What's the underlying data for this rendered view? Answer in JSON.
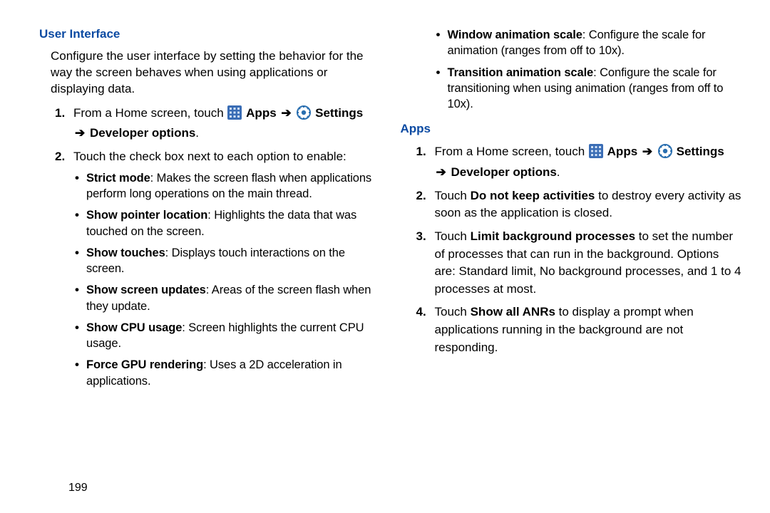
{
  "page_number": "199",
  "left": {
    "section_title": "User Interface",
    "intro": "Configure the user interface by setting the behavior for the way the screen behaves when using applications or displaying data.",
    "step1_prefix": "From a Home screen, touch ",
    "apps_label": "Apps",
    "settings_label": "Settings",
    "dev_options_label": "Developer options",
    "step2_text": "Touch the check box next to each option to enable:",
    "bullets": {
      "b0_bold": "Strict mode",
      "b0_rest": ": Makes the screen flash when applications perform long operations on the main thread.",
      "b1_bold": "Show pointer location",
      "b1_rest": ": Highlights the data that was touched on the screen.",
      "b2_bold": "Show touches",
      "b2_rest": ": Displays touch interactions on the screen.",
      "b3_bold": "Show screen updates",
      "b3_rest": ": Areas of the screen flash when they update.",
      "b4_bold": "Show CPU usage",
      "b4_rest": ": Screen highlights the current CPU usage.",
      "b5_bold": "Force GPU rendering",
      "b5_rest": ": Uses a 2D acceleration in applications."
    }
  },
  "right": {
    "top_bullets": {
      "b0_bold": "Window animation scale",
      "b0_rest": ": Configure the scale for animation (ranges from off to 10x).",
      "b1_bold": "Transition animation scale",
      "b1_rest": ": Configure the scale for transitioning when using animation (ranges from off to 10x)."
    },
    "section_title": "Apps",
    "step1_prefix": "From a Home screen, touch ",
    "apps_label": "Apps",
    "settings_label": "Settings",
    "dev_options_label": "Developer options",
    "step2_a": "Touch ",
    "step2_bold": "Do not keep activities",
    "step2_b": " to destroy every activity as soon as the application is closed.",
    "step3_a": "Touch ",
    "step3_bold": "Limit background processes",
    "step3_b": " to set the number of processes that can run in the background. Options are: Standard limit, No background processes, and 1 to 4 processes at most.",
    "step4_a": "Touch ",
    "step4_bold": "Show all ANRs",
    "step4_b": " to display a prompt when applications running in the background are not responding."
  }
}
